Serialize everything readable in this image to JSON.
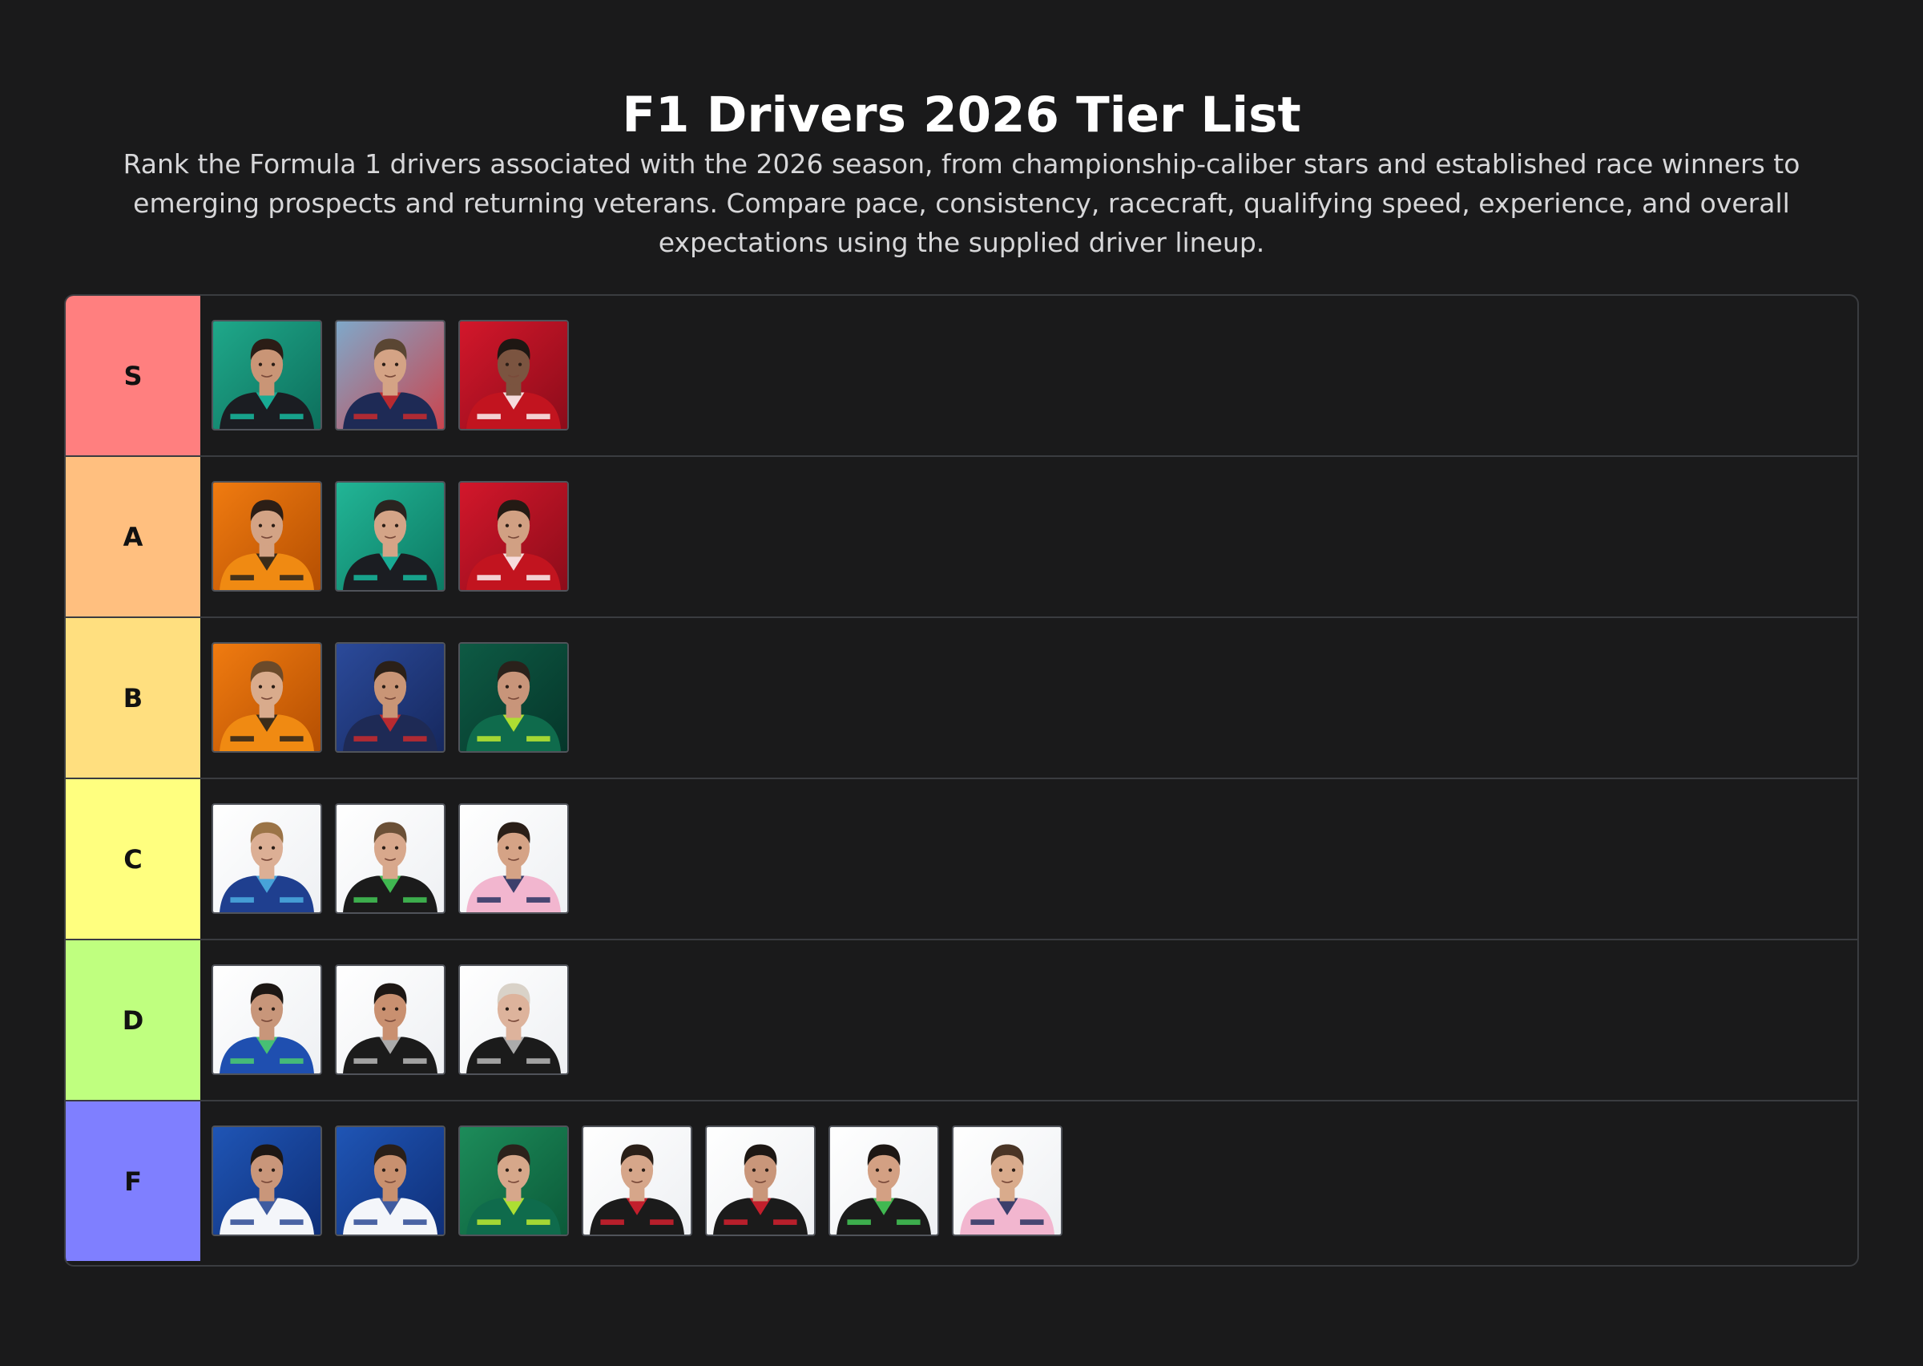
{
  "header": {
    "title": "F1 Drivers 2026 Tier List",
    "description": "Rank the Formula 1 drivers associated with the 2026 season, from championship-caliber stars and established race winners to emerging prospects and returning veterans. Compare pace, consistency, racecraft, qualifying speed, experience, and overall expectations using the supplied driver lineup."
  },
  "tiers": [
    {
      "label": "S",
      "color": "#ff7f7f",
      "items": [
        {
          "bg": "#1fa88a",
          "bg2": "#0d6f5c",
          "suit": "#1b1d22",
          "accent": "#17c4a8",
          "skin": "#c99576",
          "hair": "#2b1d16"
        },
        {
          "bg": "#7fa8c9",
          "bg2": "#c9454f",
          "suit": "#1e2a55",
          "accent": "#d32a2a",
          "skin": "#d4a385",
          "hair": "#5a4633"
        },
        {
          "bg": "#d3172b",
          "bg2": "#8c0c1a",
          "suit": "#c2141f",
          "accent": "#ffffff",
          "skin": "#7b5440",
          "hair": "#1e1713"
        }
      ]
    },
    {
      "label": "A",
      "color": "#ffbf7f",
      "items": [
        {
          "bg": "#f07b10",
          "bg2": "#b54f02",
          "suit": "#f08a12",
          "accent": "#1b1b1b",
          "skin": "#d3a385",
          "hair": "#2c1e16"
        },
        {
          "bg": "#22b596",
          "bg2": "#0c7a63",
          "suit": "#1b1d22",
          "accent": "#17c4a8",
          "skin": "#d4a487",
          "hair": "#2a2420"
        },
        {
          "bg": "#d3172b",
          "bg2": "#8c0c1a",
          "suit": "#c2141f",
          "accent": "#ffffff",
          "skin": "#d1a083",
          "hair": "#241a14"
        }
      ]
    },
    {
      "label": "B",
      "color": "#ffdf7f",
      "items": [
        {
          "bg": "#f07b10",
          "bg2": "#b54f02",
          "suit": "#f08a12",
          "accent": "#1b1b1b",
          "skin": "#d9ab8c",
          "hair": "#6b4a2a"
        },
        {
          "bg": "#2b4a9a",
          "bg2": "#16285e",
          "suit": "#1e2a55",
          "accent": "#d32a2a",
          "skin": "#c99576",
          "hair": "#2b2018"
        },
        {
          "bg": "#0e5a44",
          "bg2": "#05362a",
          "suit": "#0f6b4c",
          "accent": "#c9f22e",
          "skin": "#c8957a",
          "hair": "#2a211b"
        }
      ]
    },
    {
      "label": "C",
      "color": "#ffff7f",
      "items": [
        {
          "bg": "#ffffff",
          "bg2": "#eef0f3",
          "suit": "#1f3f8f",
          "accent": "#4fb5e6",
          "skin": "#dcaf95",
          "hair": "#9b7447"
        },
        {
          "bg": "#ffffff",
          "bg2": "#eef0f3",
          "suit": "#1b1b1b",
          "accent": "#46d35a",
          "skin": "#d8a88c",
          "hair": "#6b5037"
        },
        {
          "bg": "#ffffff",
          "bg2": "#eef0f3",
          "suit": "#f2b6cf",
          "accent": "#1b2a5a",
          "skin": "#d5a386",
          "hair": "#2a1f18"
        }
      ]
    },
    {
      "label": "D",
      "color": "#bfff7f",
      "items": [
        {
          "bg": "#ffffff",
          "bg2": "#eef0f3",
          "suit": "#1f4fb0",
          "accent": "#4fd46a",
          "skin": "#c8967a",
          "hair": "#1d1714"
        },
        {
          "bg": "#ffffff",
          "bg2": "#eef0f3",
          "suit": "#1b1b1b",
          "accent": "#c4c4c4",
          "skin": "#c99070",
          "hair": "#1d1714"
        },
        {
          "bg": "#ffffff",
          "bg2": "#eef0f3",
          "suit": "#1b1b1b",
          "accent": "#c4c4c4",
          "skin": "#ddb39c",
          "hair": "#d9d2c8"
        }
      ]
    },
    {
      "label": "F",
      "color": "#7f7fff",
      "items": [
        {
          "bg": "#1f55b5",
          "bg2": "#0f2f78",
          "suit": "#f4f6fa",
          "accent": "#1f3f8f",
          "skin": "#c9967a",
          "hair": "#1d1714"
        },
        {
          "bg": "#1f55b5",
          "bg2": "#0f2f78",
          "suit": "#f4f6fa",
          "accent": "#1f3f8f",
          "skin": "#c8906f",
          "hair": "#2a1f18"
        },
        {
          "bg": "#1d8c5a",
          "bg2": "#0b5a39",
          "suit": "#0f6b4c",
          "accent": "#c9f22e",
          "skin": "#d6a78a",
          "hair": "#2b211b"
        },
        {
          "bg": "#ffffff",
          "bg2": "#eef0f3",
          "suit": "#1b1b1b",
          "accent": "#e0202f",
          "skin": "#d6a68a",
          "hair": "#2a1f18"
        },
        {
          "bg": "#ffffff",
          "bg2": "#eef0f3",
          "suit": "#1b1b1b",
          "accent": "#e0202f",
          "skin": "#c9967a",
          "hair": "#1d1714"
        },
        {
          "bg": "#ffffff",
          "bg2": "#eef0f3",
          "suit": "#1b1b1b",
          "accent": "#46d35a",
          "skin": "#d3a083",
          "hair": "#1d1714"
        },
        {
          "bg": "#ffffff",
          "bg2": "#eef0f3",
          "suit": "#f2b6cf",
          "accent": "#1b2a5a",
          "skin": "#d9ab8c",
          "hair": "#4a3526"
        }
      ]
    }
  ]
}
